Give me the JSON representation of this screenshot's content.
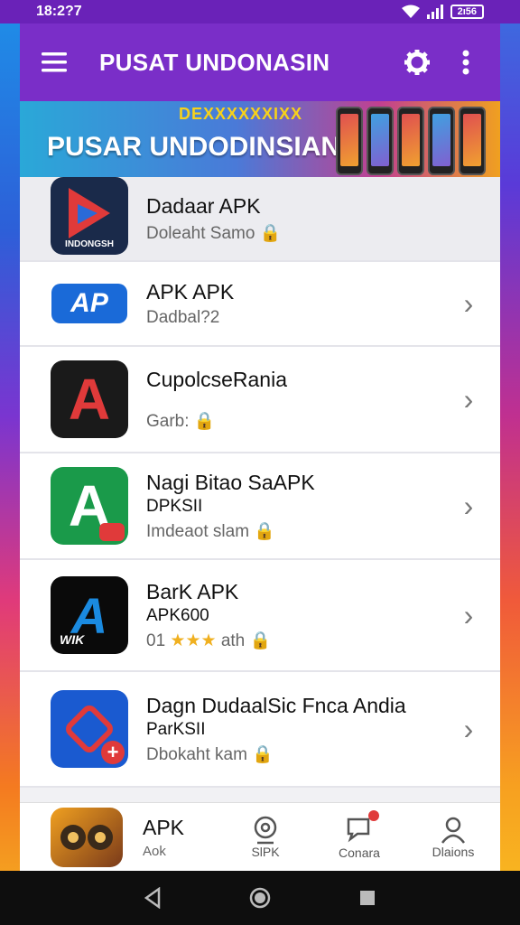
{
  "status_bar": {
    "time": "18:2?7",
    "battery": "2ı56"
  },
  "appbar": {
    "title": "PUSAT UNDONASIN"
  },
  "banner": {
    "top_text": "DEXXXXXXIXX",
    "main_text": "PUSAR UNDODINSIAN"
  },
  "apps": [
    {
      "name": "Dadaar APK",
      "sub": "",
      "desc": "Doleaht Samo",
      "icon_label": "INDONGSH",
      "colors": [
        "#e03a3a",
        "#2a6ad8"
      ]
    },
    {
      "name": "APK APK",
      "sub": "",
      "desc": "Dadbal?2",
      "icon_label": "AP",
      "colors": [
        "#1a6ad8",
        "#3a8ae8"
      ]
    },
    {
      "name": "CupolcseRania",
      "sub": "",
      "desc": "Garb:",
      "icon_label": "A",
      "colors": [
        "#d02a2a",
        "#1a1a1a"
      ]
    },
    {
      "name": "Nagi Bitao SaAPK",
      "sub": "DPKSII",
      "desc": "Imdeaot slam",
      "icon_label": "A",
      "colors": [
        "#1a9a4a",
        "#e03a3a"
      ]
    },
    {
      "name": "BarK APK",
      "sub": "APK600",
      "desc": "01",
      "desc_after": "ath",
      "icon_label": "WIK",
      "colors": [
        "#0a0a0a",
        "#1a8ae0"
      ]
    },
    {
      "name": "Dagn DudaalSic Fnca Andia",
      "sub": "ParKSII",
      "desc": "Dbokaht kam",
      "icon_label": "+",
      "colors": [
        "#1a5ad0",
        "#e03a3a"
      ]
    },
    {
      "name": "APK",
      "sub": "Aok",
      "desc": "",
      "icon_label": "",
      "colors": [
        "#f0a020",
        "#7a3a1a"
      ]
    }
  ],
  "bottom_nav": [
    {
      "label": "SlPK",
      "icon": "webcam-icon"
    },
    {
      "label": "Conara",
      "icon": "notification-chat-icon"
    },
    {
      "label": "Dlaions",
      "icon": "profile-icon"
    }
  ],
  "system_nav": [
    "back-icon",
    "home-icon",
    "recents-icon"
  ]
}
